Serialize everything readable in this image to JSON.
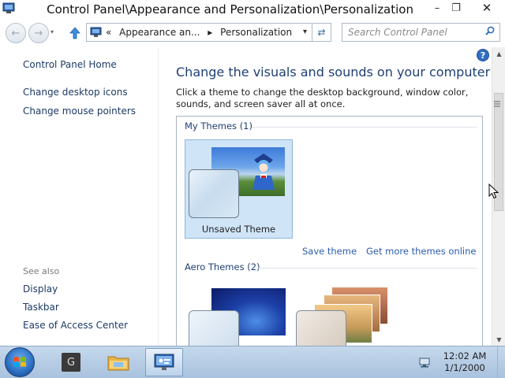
{
  "window": {
    "title": "Control Panel\\Appearance and Personalization\\Personalization",
    "min_glyph": "–",
    "max_glyph": "❐",
    "close_glyph": "✕"
  },
  "address": {
    "breadcrumb_prefix": "«",
    "crumb_1": "Appearance an...",
    "crumb_sep": "▸",
    "crumb_2": "Personalization",
    "dropdown_glyph": "▾",
    "search_placeholder": "Search Control Panel"
  },
  "sidebar": {
    "home": "Control Panel Home",
    "links": [
      "Change desktop icons",
      "Change mouse pointers"
    ],
    "see_also_heading": "See also",
    "see_also": [
      "Display",
      "Taskbar",
      "Ease of Access Center"
    ]
  },
  "main": {
    "heading": "Change the visuals and sounds on your computer",
    "description": "Click a theme to change the desktop background, window color, sounds, and screen saver all at once.",
    "my_themes_label": "My Themes (1)",
    "selected_theme_name": "Unsaved Theme",
    "save_theme_link": "Save theme",
    "get_more_link": "Get more themes online",
    "aero_themes_label": "Aero Themes (2)"
  },
  "taskbar": {
    "app_g_label": "G",
    "clock_time": "12:02 AM",
    "clock_date": "1/1/2000"
  },
  "icons": {
    "help": "?",
    "up": "🠅",
    "search": "⌕",
    "refresh": "⇄"
  },
  "colors": {
    "link": "#2a5bb0",
    "heading": "#1e3f73",
    "selection": "#cfe4f7",
    "taskbar": "#b5cbe4"
  }
}
